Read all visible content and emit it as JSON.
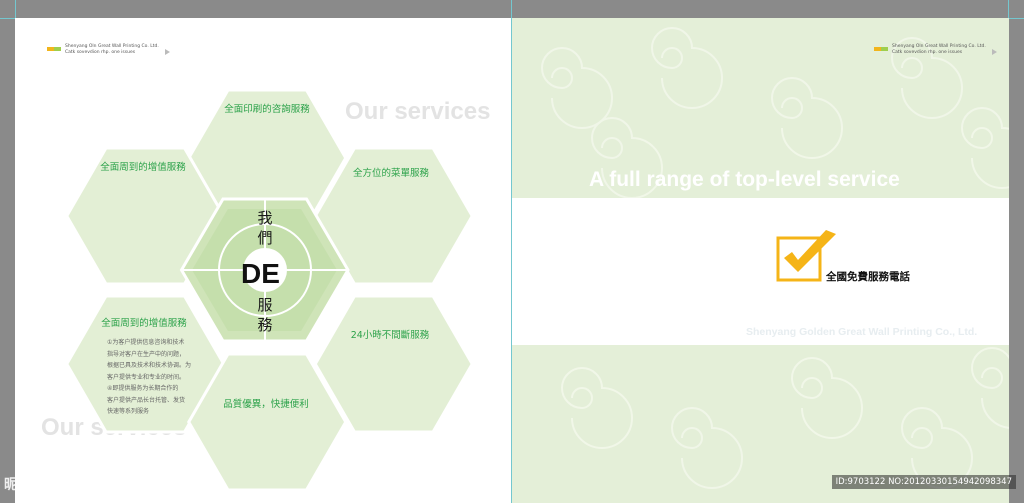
{
  "left_page": {
    "header_lines": [
      "Shenyang Oln Great Wall Printing Co. Ltd.",
      "Catk sovevdion rhp. one issues"
    ],
    "watermarks": [
      "Our services",
      "Our services"
    ],
    "hexagons": {
      "top": "全面印刷的咨詢服務",
      "upper_left": "全面周到的增值服務",
      "upper_right": "全方位的菜單服務",
      "lower_left": "全面周到的增值服務",
      "lower_right": "24小時不間斷服務",
      "bottom": "品質優異，快捷便利"
    },
    "center": {
      "top_chars": [
        "我",
        "們"
      ],
      "logo_text": "DE",
      "bottom_chars": [
        "服",
        "務"
      ]
    },
    "body_lines": [
      "①为客户提供信息咨询和技术",
      "指导对客户在生产中的问题，",
      "根据已具及技术和技术协调。为",
      "客户提供专业和专业的时间。",
      "④即提供服务为长期合作的",
      "客户提供产品长台托管、发货",
      "快速等系列服务"
    ]
  },
  "right_page": {
    "header_lines": [
      "Shenyang Oln Great Wall Printing Co. Ltd.",
      "Catk sovevdion rhp. one issues"
    ],
    "band_title": "A full range of top-level service",
    "hotline": "全國免費服務電話",
    "company_en": "Shenyang Golden Great Wall Printing Co., Ltd."
  },
  "footer": {
    "credit": "ID:9703122 NO:20120330154942098347",
    "site": "昵享网 www.nipic.com"
  },
  "colors": {
    "hex_light": "#e3efd5",
    "hex_center": "#cfe4b8",
    "label_green": "#2ca24a",
    "check_yellow": "#f5b417",
    "right_bg": "#e4efd8"
  }
}
